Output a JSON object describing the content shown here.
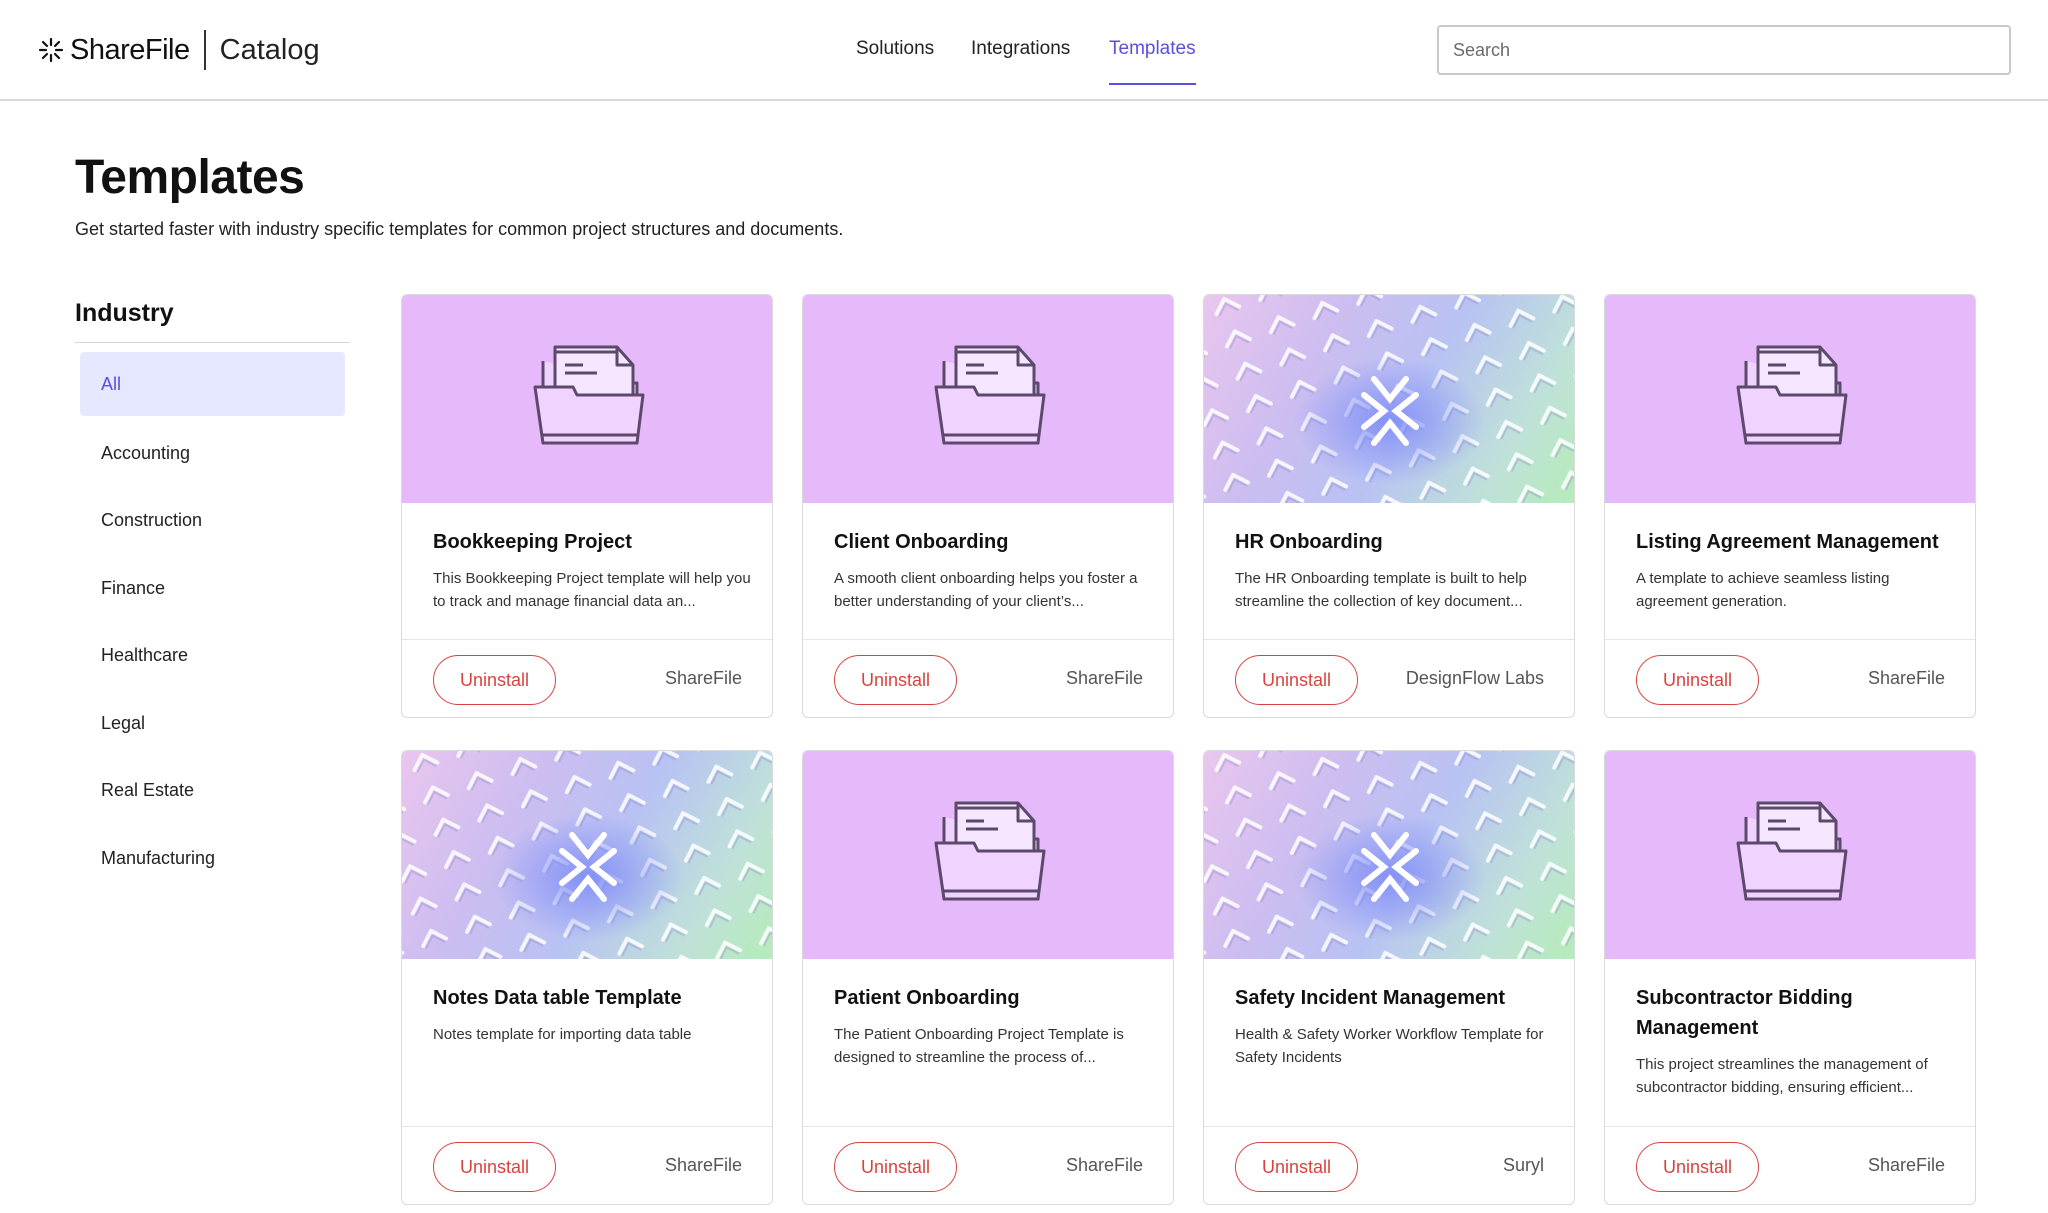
{
  "header": {
    "brand": "ShareFile",
    "section": "Catalog",
    "nav": [
      {
        "label": "Solutions",
        "active": false
      },
      {
        "label": "Integrations",
        "active": false
      },
      {
        "label": "Templates",
        "active": true
      }
    ],
    "search_placeholder": "Search"
  },
  "page": {
    "title": "Templates",
    "subtitle": "Get started faster with industry specific templates for common project structures and documents."
  },
  "sidebar": {
    "title": "Industry",
    "items": [
      "All",
      "Accounting",
      "Construction",
      "Finance",
      "Healthcare",
      "Legal",
      "Real Estate",
      "Manufacturing"
    ],
    "selected": "All"
  },
  "colors": {
    "accent": "#5a4fe0",
    "danger": "#d9433f",
    "card_image_purple": "#e6b9fb",
    "selected_bg": "#e6e8ff"
  },
  "cards": [
    {
      "title": "Bookkeeping Project",
      "description": "This Bookkeeping Project template will help you to track and manage financial data an...",
      "button": "Uninstall",
      "vendor": "ShareFile",
      "image": "folder-icon"
    },
    {
      "title": "Client Onboarding",
      "description": "A smooth client onboarding helps you foster a better understanding of your client’s...",
      "button": "Uninstall",
      "vendor": "ShareFile",
      "image": "folder-icon"
    },
    {
      "title": "HR Onboarding",
      "description": "The HR Onboarding template is built to help streamline the collection of key document...",
      "button": "Uninstall",
      "vendor": "DesignFlow Labs",
      "image": "arrows-pattern"
    },
    {
      "title": "Listing Agreement Management",
      "description": "A template to achieve seamless listing agreement generation.",
      "button": "Uninstall",
      "vendor": "ShareFile",
      "image": "folder-icon"
    },
    {
      "title": "Notes Data table Template",
      "description": "Notes template for importing data table",
      "button": "Uninstall",
      "vendor": "ShareFile",
      "image": "arrows-pattern"
    },
    {
      "title": "Patient Onboarding",
      "description": "The Patient Onboarding Project Template is designed to streamline the process of...",
      "button": "Uninstall",
      "vendor": "ShareFile",
      "image": "folder-icon"
    },
    {
      "title": "Safety Incident Management",
      "description": "Health & Safety Worker Workflow Template for Safety Incidents",
      "button": "Uninstall",
      "vendor": "Suryl",
      "image": "arrows-pattern"
    },
    {
      "title": "Subcontractor Bidding Management",
      "description": "This project streamlines the management of subcontractor bidding, ensuring efficient...",
      "button": "Uninstall",
      "vendor": "ShareFile",
      "image": "folder-icon"
    }
  ]
}
